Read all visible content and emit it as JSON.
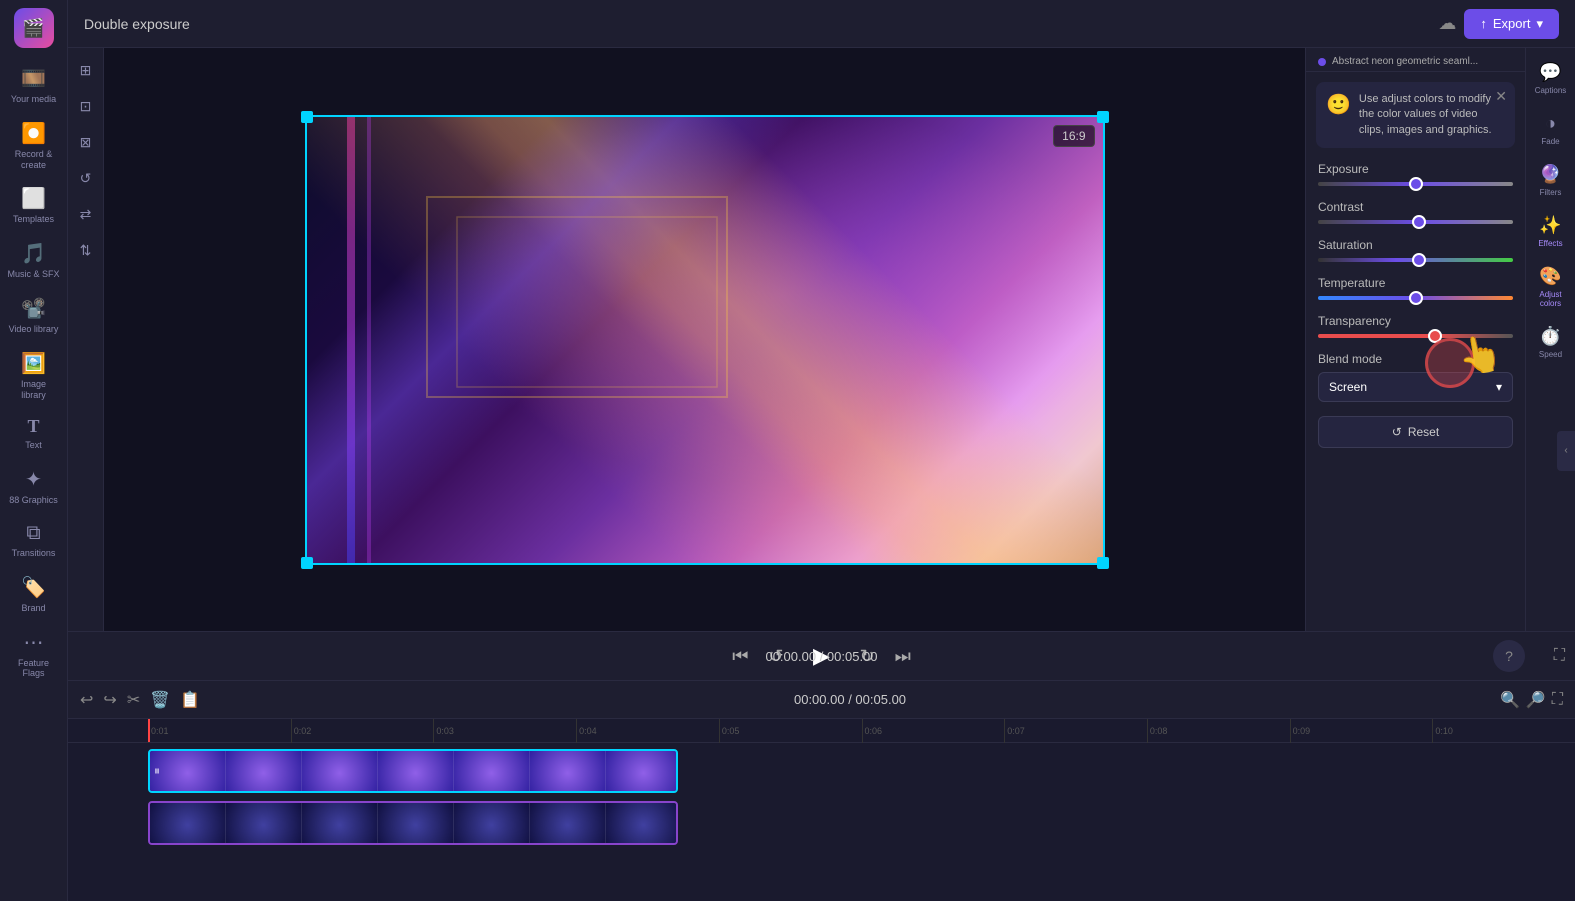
{
  "app": {
    "title": "Double exposure",
    "logo": "🎬"
  },
  "topbar": {
    "project_name": "Double exposure",
    "export_label": "Export",
    "aspect_ratio": "16:9"
  },
  "left_sidebar": {
    "items": [
      {
        "id": "my-media",
        "icon": "🎞️",
        "label": "Your media"
      },
      {
        "id": "record",
        "icon": "⏺️",
        "label": "Record & create"
      },
      {
        "id": "templates",
        "icon": "⬜",
        "label": "Templates"
      },
      {
        "id": "music",
        "icon": "🎵",
        "label": "Music & SFX"
      },
      {
        "id": "video-library",
        "icon": "📽️",
        "label": "Video library"
      },
      {
        "id": "image-library",
        "icon": "🖼️",
        "label": "Image library"
      },
      {
        "id": "text",
        "icon": "T",
        "label": "Text"
      },
      {
        "id": "graphics",
        "icon": "✦",
        "label": "88 Graphics"
      },
      {
        "id": "transitions",
        "icon": "⧉",
        "label": "Transitions"
      },
      {
        "id": "brand-kit",
        "icon": "🏷️",
        "label": "Brand"
      },
      {
        "id": "feature-flags",
        "icon": "⋯",
        "label": "Feature Flags"
      }
    ]
  },
  "playback": {
    "current_time": "00:00.00",
    "total_time": "00:05.00",
    "time_display": "00:00.00 / 00:05.00"
  },
  "timeline": {
    "toolbar_icons": [
      "↩",
      "↪",
      "✂",
      "🗑️",
      "📋"
    ],
    "ruler_marks": [
      "0:01",
      "0:02",
      "0:03",
      "0:04",
      "0:05",
      "0:06",
      "0:07",
      "0:08",
      "0:09",
      "0:10"
    ]
  },
  "right_panel": {
    "header_text": "Abstract neon geometric seaml...",
    "info_message": "Use adjust colors to modify the color values of video clips, images and graphics.",
    "sliders": {
      "exposure_label": "Exposure",
      "exposure_value": 50,
      "contrast_label": "Contrast",
      "contrast_value": 52,
      "saturation_label": "Saturation",
      "saturation_value": 52,
      "temperature_label": "Temperature",
      "temperature_value": 50,
      "transparency_label": "Transparency",
      "transparency_value": 60,
      "blend_mode_label": "Blend mode",
      "blend_mode_value": "Screen"
    },
    "reset_label": "Reset"
  },
  "far_right_panel": {
    "items": [
      {
        "id": "captions",
        "icon": "💬",
        "label": "Captions"
      },
      {
        "id": "fade",
        "icon": "◑",
        "label": "Fade"
      },
      {
        "id": "filters",
        "icon": "🔮",
        "label": "Filters"
      },
      {
        "id": "effects",
        "icon": "✨",
        "label": "Effects"
      },
      {
        "id": "adjust-colors",
        "icon": "🎨",
        "label": "Adjust colors"
      },
      {
        "id": "speed",
        "icon": "⏱️",
        "label": "Speed"
      }
    ]
  }
}
